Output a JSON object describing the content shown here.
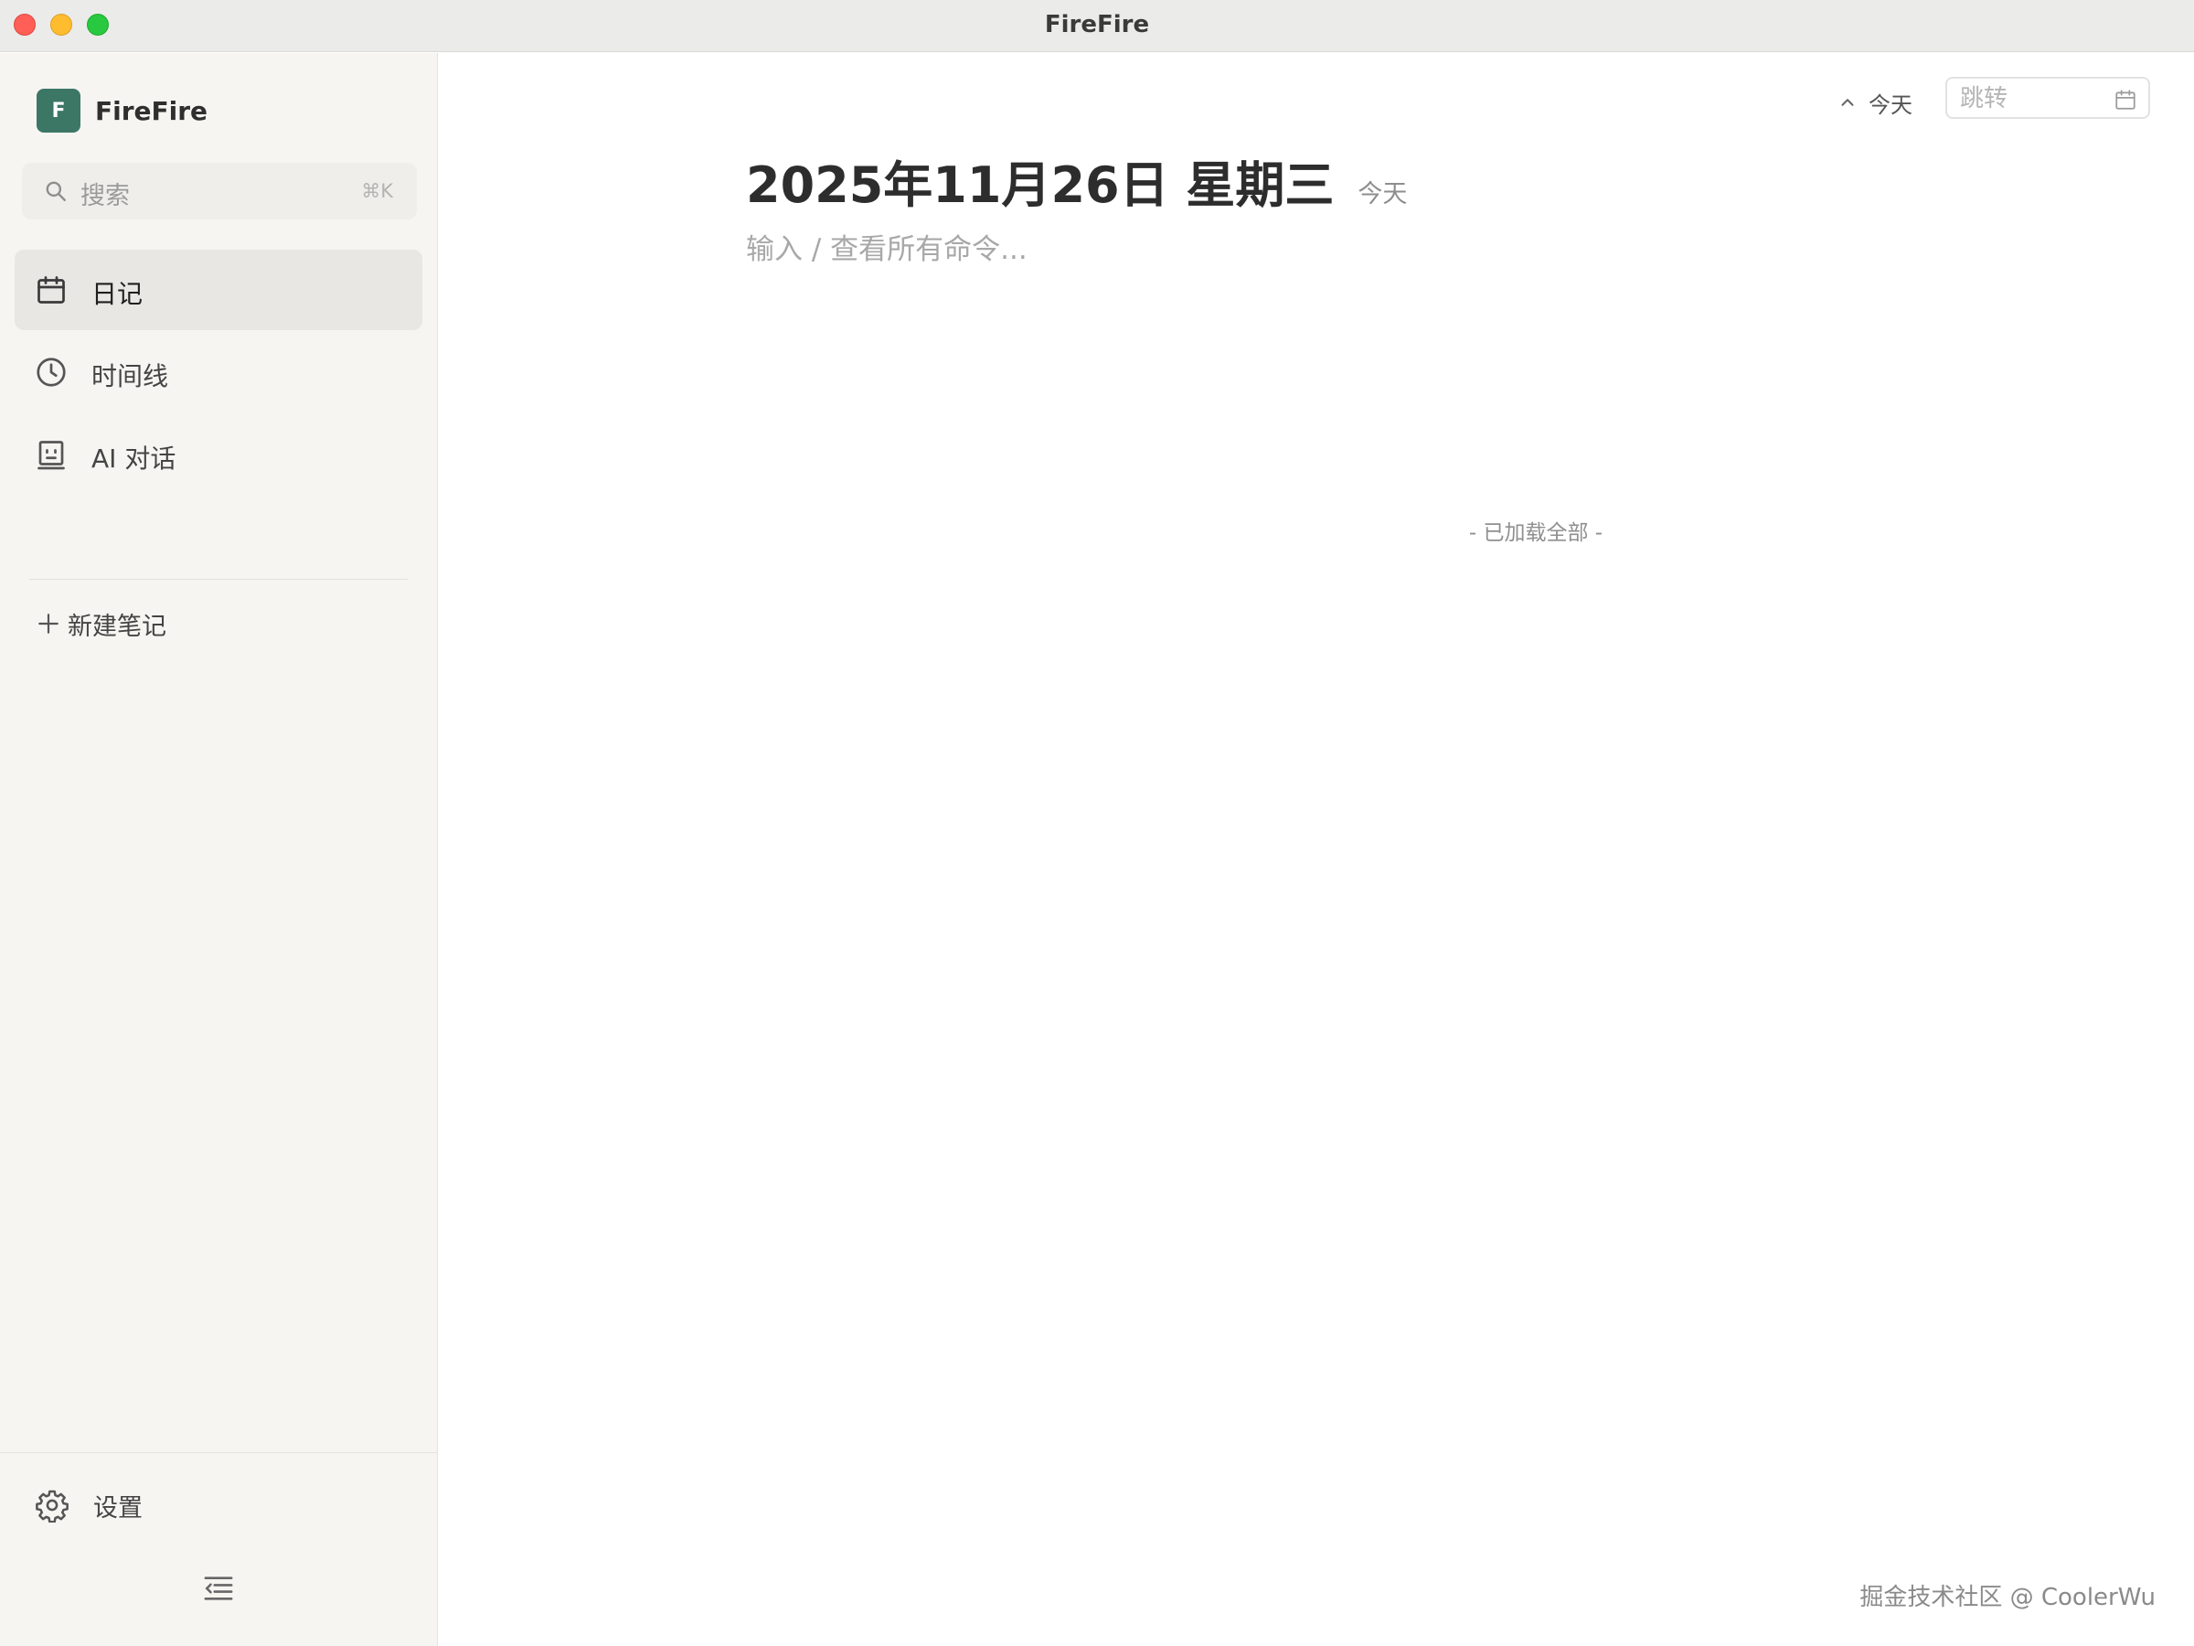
{
  "window": {
    "title": "FireFire"
  },
  "sidebar": {
    "brand": {
      "logo_letter": "F",
      "name": "FireFire",
      "logo_color": "#3c7766"
    },
    "search": {
      "placeholder": "搜索",
      "shortcut": "⌘K"
    },
    "nav": [
      {
        "label": "日记",
        "icon": "calendar-icon",
        "active": true
      },
      {
        "label": "时间线",
        "icon": "clock-icon",
        "active": false
      },
      {
        "label": "AI 对话",
        "icon": "robot-icon",
        "active": false
      }
    ],
    "new_note": {
      "icon": "plus-icon",
      "label": "新建笔记"
    },
    "settings": {
      "icon": "gear-icon",
      "label": "设置"
    },
    "collapse": {
      "icon": "collapse-sidebar-icon"
    }
  },
  "main": {
    "toolbar": {
      "today_label": "今天",
      "jump": {
        "placeholder": "跳转",
        "value": ""
      }
    },
    "date_title": "2025年11月26日 星期三",
    "date_badge": "今天",
    "editor_placeholder": "输入 / 查看所有命令...",
    "loaded_all": "- 已加载全部 -"
  },
  "watermark": "掘金技术社区 @ CoolerWu"
}
